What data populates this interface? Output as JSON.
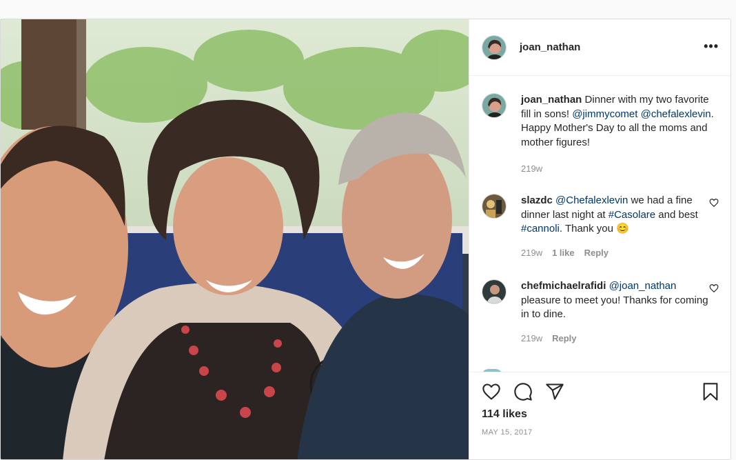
{
  "post": {
    "author": "joan_nathan",
    "more_icon": "more-horizontal-icon",
    "likes": "114 likes",
    "date": "MAY 15, 2017"
  },
  "caption": {
    "username": "joan_nathan",
    "text_start": " Dinner with my two favorite fill in sons! ",
    "mention1": "@jimmycomet",
    "mention2": "@chefalexlevin",
    "text_end": ". Happy Mother's Day to all the moms and mother figures!",
    "age": "219w"
  },
  "comments": [
    {
      "username": "slazdc",
      "mention": "@Chefalexlevin",
      "text1": " we had a fine dinner last night at ",
      "tag1": "#Casolare",
      "text2": " and best ",
      "tag2": "#cannoli",
      "text3": ". Thank you 😊",
      "age": "219w",
      "likes": "1 like",
      "reply": "Reply"
    },
    {
      "username": "chefmichaelrafidi",
      "mention": "@joan_nathan",
      "text1": " pleasure to meet you! Thanks for coming in to dine.",
      "age": "219w",
      "reply": "Reply"
    }
  ],
  "colors": {
    "link": "#00376b",
    "muted": "#8e8e8e",
    "border": "#dbdbdb"
  }
}
